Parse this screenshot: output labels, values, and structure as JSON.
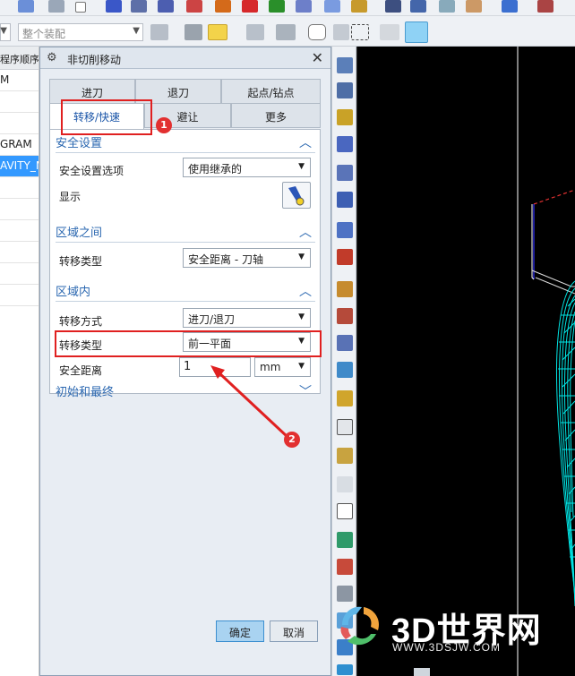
{
  "toolbar": {
    "assembly_combo": "整个装配"
  },
  "navigator": {
    "header": "程序顺序",
    "rows": [
      "M",
      "",
      "",
      "GRAM",
      "AVITY_N",
      "",
      "",
      "",
      "",
      "",
      ""
    ]
  },
  "dialog": {
    "title": "非切削移动",
    "tabs_row1": [
      "进刀",
      "退刀",
      "起点/钻点"
    ],
    "tabs_row2": [
      "转移/快速",
      "避让",
      "更多"
    ],
    "sections": {
      "safety": {
        "title": "安全设置",
        "option_label": "安全设置选项",
        "option_value": "使用继承的",
        "display_label": "显示"
      },
      "between_regions": {
        "title": "区域之间",
        "transfer_type_label": "转移类型",
        "transfer_type_value": "安全距离 - 刀轴"
      },
      "within_region": {
        "title": "区域内",
        "transfer_mode_label": "转移方式",
        "transfer_mode_value": "进刀/退刀",
        "transfer_type_label": "转移类型",
        "transfer_type_value": "前一平面",
        "safe_distance_label": "安全距离",
        "safe_distance_value": "1",
        "safe_distance_unit": "mm"
      },
      "initial_final": {
        "title": "初始和最终"
      }
    },
    "ok_label": "确定",
    "cancel_label": "取消"
  },
  "annotations": {
    "badge1": "1",
    "badge2": "2"
  },
  "watermark": {
    "brand": "3D世界网",
    "url": "WWW.3DSJW.COM"
  },
  "colors": {
    "accent": "#2a67b0",
    "highlight": "#e02020",
    "toolpath": "#00e5e5"
  }
}
